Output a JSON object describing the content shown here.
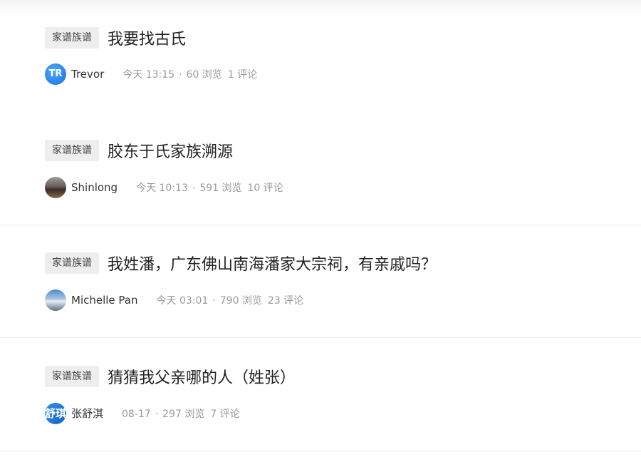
{
  "posts": [
    {
      "tag": "家谱族谱",
      "title": "我要找古氏",
      "author": "Trevor",
      "avatar_text": "TR",
      "time": "今天 13:15",
      "views": "60 浏览",
      "comments": "1 评论"
    },
    {
      "tag": "家谱族谱",
      "title": "胶东于氏家族溯源",
      "author": "Shinlong",
      "avatar_text": "",
      "time": "今天 10:13",
      "views": "591 浏览",
      "comments": "10 评论"
    },
    {
      "tag": "家谱族谱",
      "title": "我姓潘，广东佛山南海潘家大宗祠，有亲戚吗？",
      "author": "Michelle Pan",
      "avatar_text": "",
      "time": "今天 03:01",
      "views": "790 浏览",
      "comments": "23 评论"
    },
    {
      "tag": "家谱族谱",
      "title": "猜猜我父亲哪的人（姓张）",
      "author": "张舒淇",
      "avatar_text": "舒琪",
      "time": "08-17",
      "views": "297 浏览",
      "comments": "7 评论"
    }
  ],
  "separator": "·"
}
